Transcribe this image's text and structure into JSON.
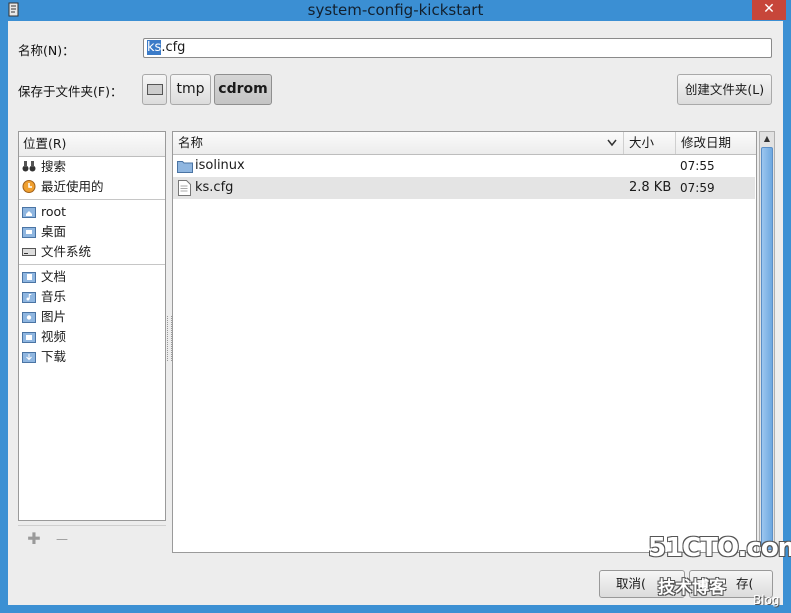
{
  "window": {
    "title": "system-config-kickstart",
    "close_glyph": "✕",
    "app_icon": "kickstart-app-icon"
  },
  "name_row": {
    "label": "名称(N)：",
    "value_selected": "ks",
    "value_rest": ".cfg"
  },
  "folder_row": {
    "label": "保存于文件夹(F)：",
    "path": [
      {
        "icon": "drive-icon"
      },
      {
        "label": "tmp"
      },
      {
        "label": "cdrom"
      }
    ],
    "create_folder_label": "创建文件夹(L)"
  },
  "places": {
    "header": "位置(R)",
    "items": [
      {
        "label": "搜索",
        "icon": "binoculars-icon"
      },
      {
        "label": "最近使用的",
        "icon": "clock-icon"
      },
      {
        "label": "root",
        "icon": "home-folder-icon"
      },
      {
        "label": "桌面",
        "icon": "desktop-folder-icon"
      },
      {
        "label": "文件系统",
        "icon": "drive-icon"
      },
      {
        "label": "文档",
        "icon": "documents-folder-icon"
      },
      {
        "label": "音乐",
        "icon": "music-folder-icon"
      },
      {
        "label": "图片",
        "icon": "pictures-folder-icon"
      },
      {
        "label": "视频",
        "icon": "videos-folder-icon"
      },
      {
        "label": "下载",
        "icon": "downloads-folder-icon"
      }
    ],
    "add_glyph": "✚",
    "remove_glyph": "—"
  },
  "files": {
    "columns": {
      "name": "名称",
      "size": "大小",
      "modified": "修改日期"
    },
    "rows": [
      {
        "name": "isolinux",
        "size": "",
        "modified": "07:55",
        "icon": "folder-icon"
      },
      {
        "name": "ks.cfg",
        "size": "2.8 KB",
        "modified": "07:59",
        "icon": "text-file-icon"
      }
    ]
  },
  "buttons": {
    "cancel": "取消(",
    "save": "存("
  },
  "watermark": {
    "line1": "51CTO.com",
    "line2": "技术博客",
    "line3": "Blog"
  },
  "colors": {
    "titlebar": "#3b8fd3",
    "selection": "#3b7bc8",
    "close_button": "#c7463a"
  }
}
